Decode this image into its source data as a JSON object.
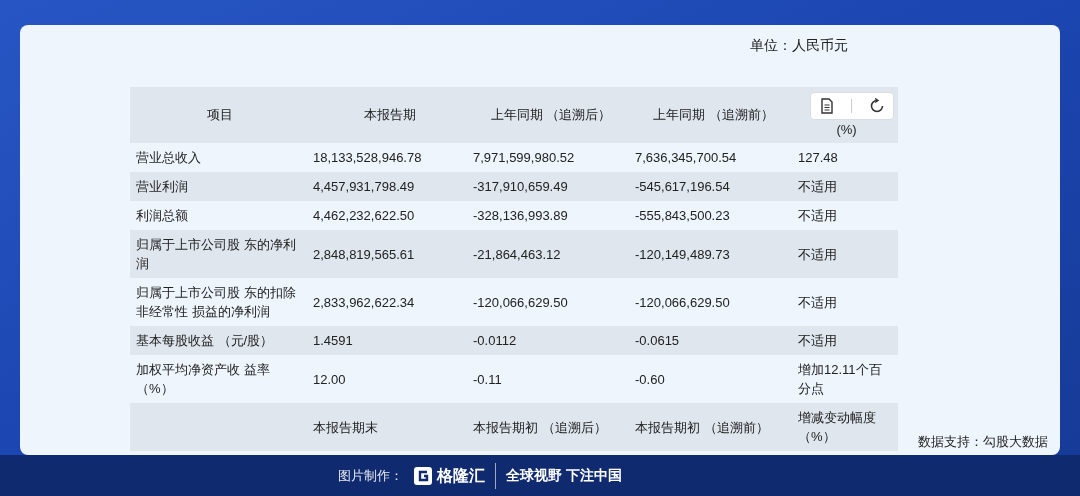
{
  "unit": "单位：人民币元",
  "table": {
    "columns": [
      "项目",
      "本报告期",
      "上年同期 （追溯后）",
      "上年同期 （追溯前）",
      "(%)"
    ],
    "rows": [
      [
        "营业总收入",
        "18,133,528,946.78",
        "7,971,599,980.52",
        "7,636,345,700.54",
        "127.48"
      ],
      [
        "营业利润",
        "4,457,931,798.49",
        "-317,910,659.49",
        "-545,617,196.54",
        "不适用"
      ],
      [
        "利润总额",
        "4,462,232,622.50",
        "-328,136,993.89",
        "-555,843,500.23",
        "不适用"
      ],
      [
        "归属于上市公司股 东的净利润",
        "2,848,819,565.61",
        "-21,864,463.12",
        "-120,149,489.73",
        "不适用"
      ],
      [
        "归属于上市公司股 东的扣除非经常性 损益的净利润",
        "2,833,962,622.34",
        "-120,066,629.50",
        "-120,066,629.50",
        "不适用"
      ],
      [
        "基本每股收益 （元/股）",
        "1.4591",
        "-0.0112",
        "-0.0615",
        "不适用"
      ],
      [
        "加权平均净资产收 益率（%）",
        "12.00",
        "-0.11",
        "-0.60",
        "增加12.11个百分点"
      ],
      [
        "",
        "本报告期末",
        "本报告期初 （追溯后）",
        "本报告期初 （追溯前）",
        "增减变动幅度（%）"
      ]
    ]
  },
  "source": "数据支持：勾股大数据",
  "footer": {
    "label": "图片制作：",
    "brand": "格隆汇",
    "slogan": "全球视野 下注中国"
  }
}
